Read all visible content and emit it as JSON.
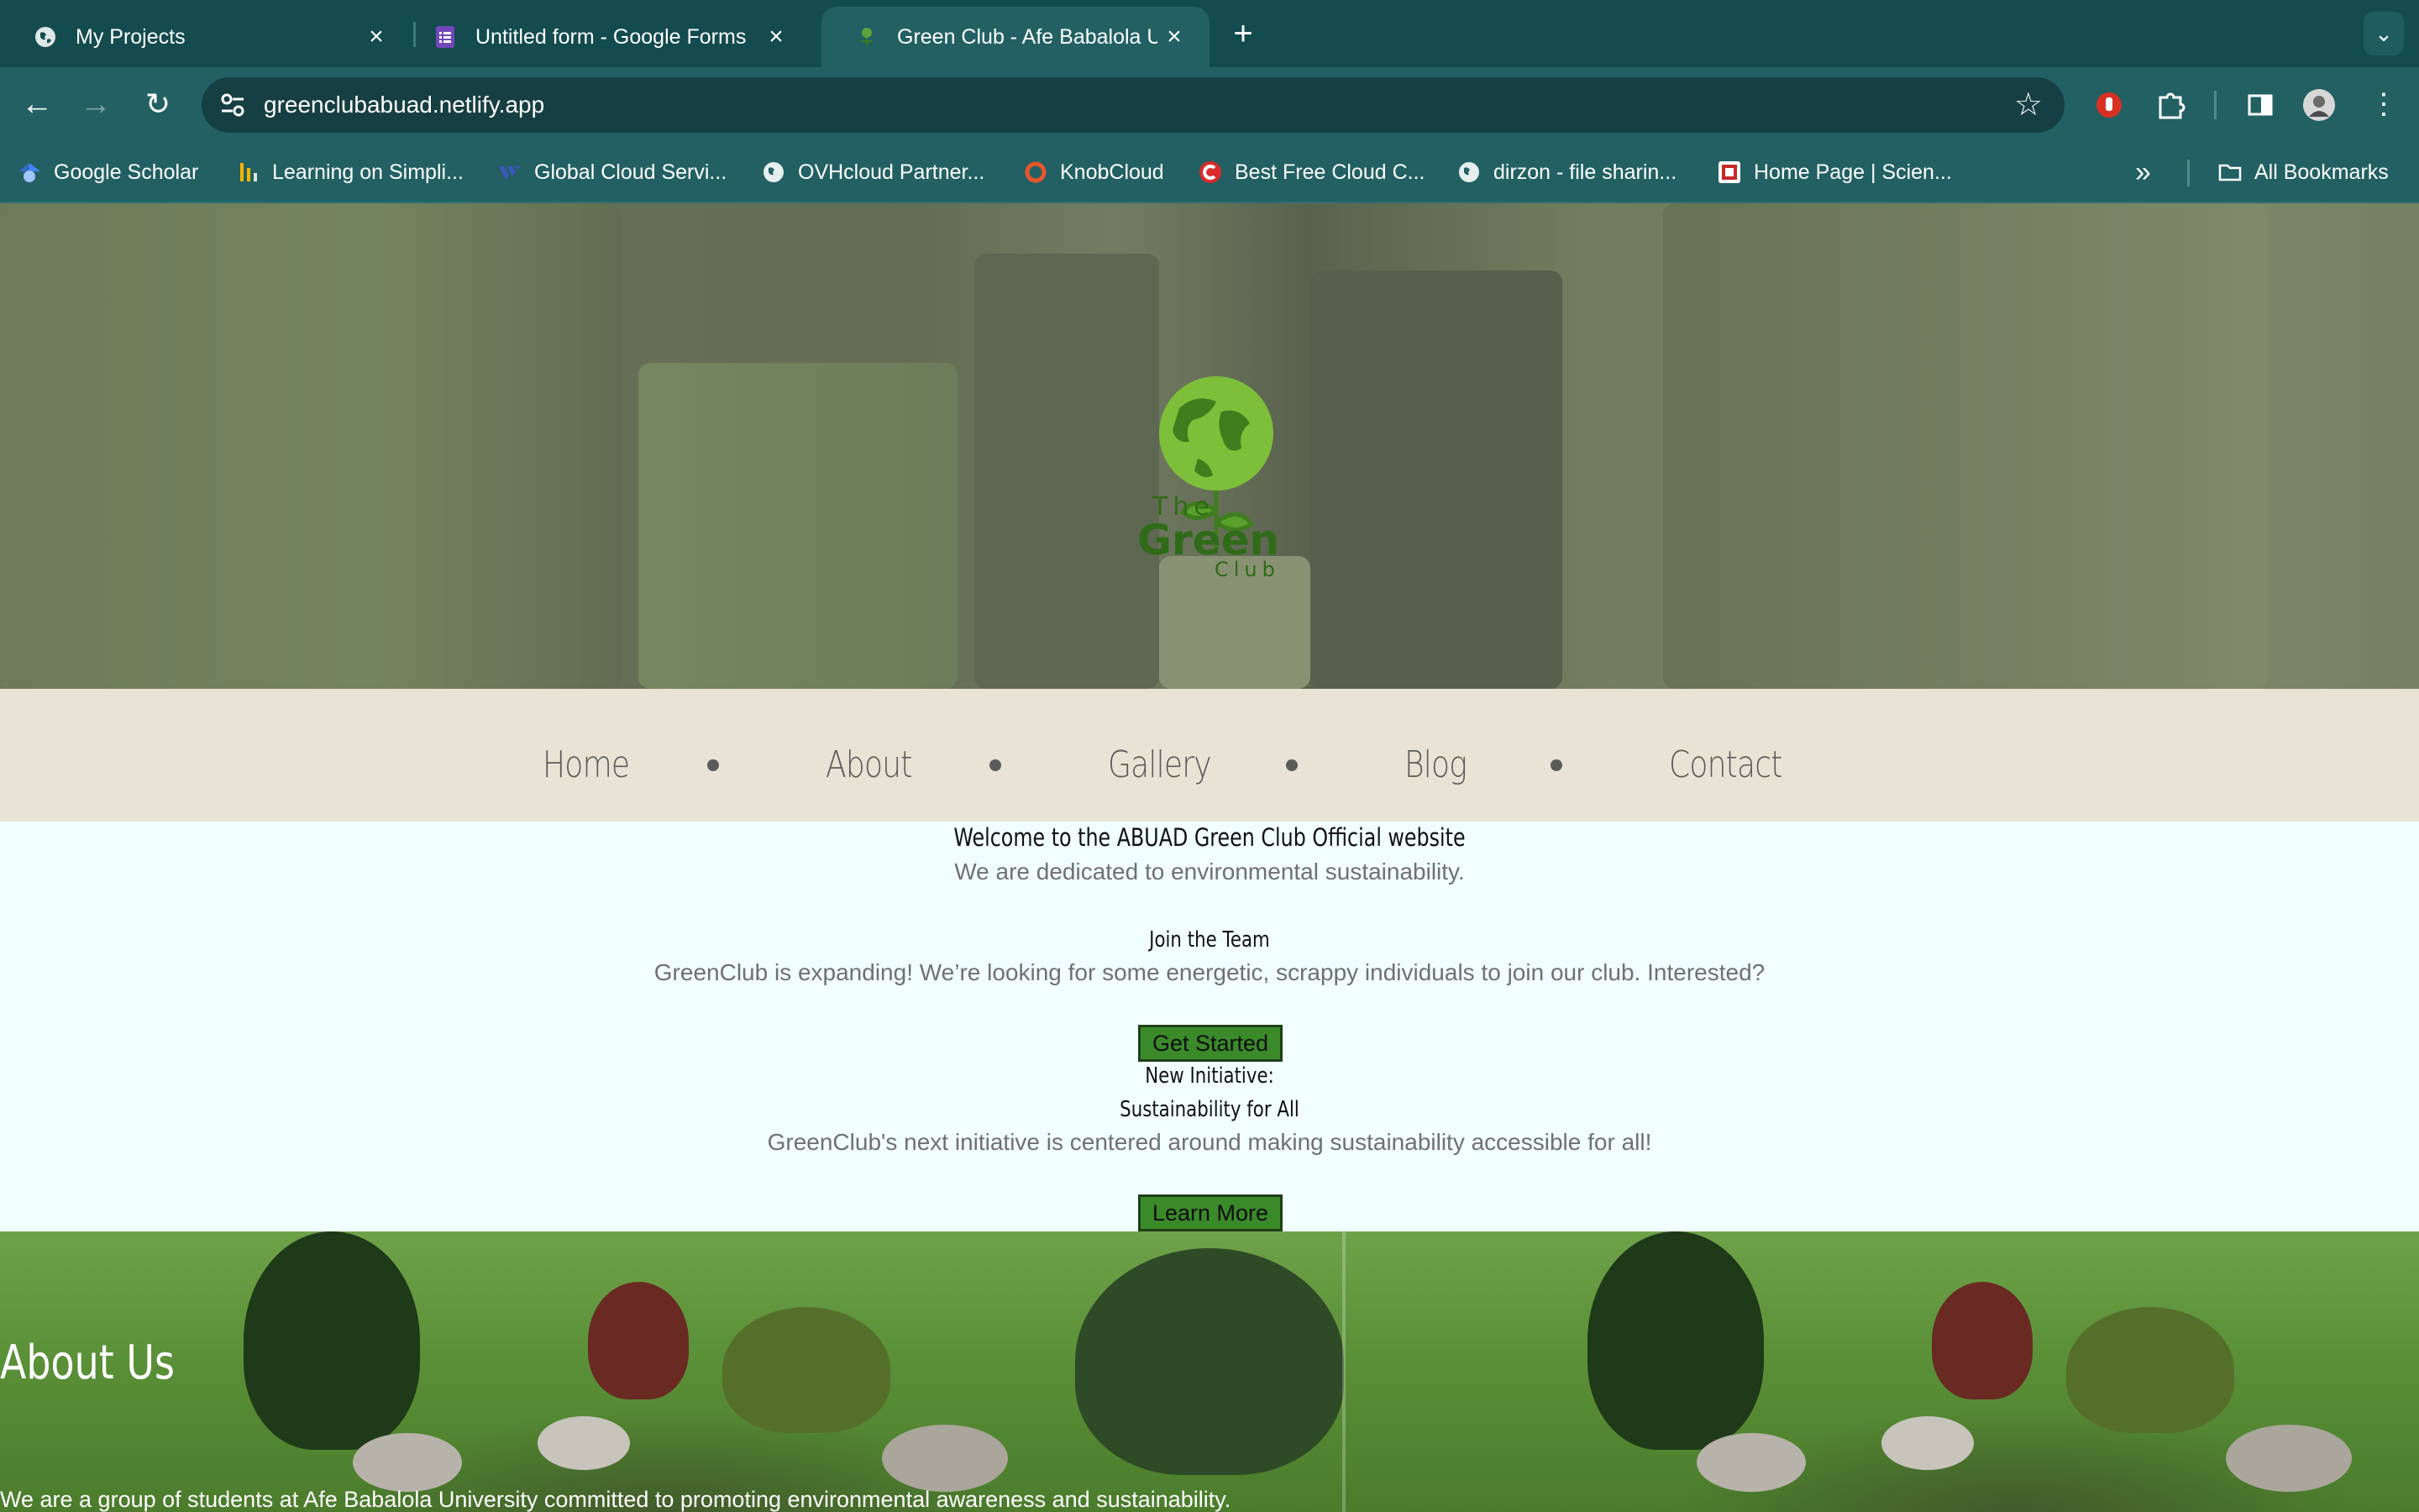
{
  "browser": {
    "tabs": [
      {
        "title": "My Projects",
        "icon": "globe-icon",
        "active": false
      },
      {
        "title": "Untitled form - Google Forms",
        "icon": "google-forms-icon",
        "active": false
      },
      {
        "title": "Green Club - Afe Babalola Uni",
        "icon": "green-club-icon",
        "active": true
      }
    ],
    "new_tab_label": "+",
    "url": "greenclubabuad.netlify.app",
    "bookmarks": [
      {
        "label": "Google Scholar",
        "icon": "google-scholar-icon"
      },
      {
        "label": "Learning on Simpli...",
        "icon": "simplilearn-icon"
      },
      {
        "label": "Global Cloud Servi...",
        "icon": "vultr-icon"
      },
      {
        "label": "OVHcloud Partner...",
        "icon": "globe-icon"
      },
      {
        "label": "KnobCloud",
        "icon": "knobcloud-icon"
      },
      {
        "label": "Best Free Cloud C...",
        "icon": "cloud-c-icon"
      },
      {
        "label": "dirzon - file sharin...",
        "icon": "globe-icon"
      },
      {
        "label": "Home Page | Scien...",
        "icon": "science-icon"
      }
    ],
    "all_bookmarks_label": "All Bookmarks"
  },
  "site": {
    "nav": [
      "Home",
      "About",
      "Gallery",
      "Blog",
      "Contact"
    ],
    "welcome_heading": "Welcome to the ABUAD Green Club Official website",
    "welcome_text": "We are dedicated to environmental sustainability.",
    "join_heading": "Join the Team",
    "join_text": "GreenClub is expanding! We’re looking for some energetic, scrappy individuals to join our club. Interested?",
    "get_started_label": "Get Started",
    "initiative_heading": "New Initiative:",
    "initiative_subheading": "Sustainability for All",
    "initiative_text": "GreenClub's next initiative is centered around making sustainability accessible for all!",
    "learn_more_label": "Learn More",
    "about_title": "About Us",
    "about_text": "We are a group of students at Afe Babalola University committed to promoting environmental awareness and sustainability."
  },
  "colors": {
    "chrome_dark": "#134b4f",
    "chrome": "#226063",
    "nav_bg": "#e8e3d5",
    "page_bg": "#f0fffe",
    "button_green": "#3a8a2a"
  }
}
